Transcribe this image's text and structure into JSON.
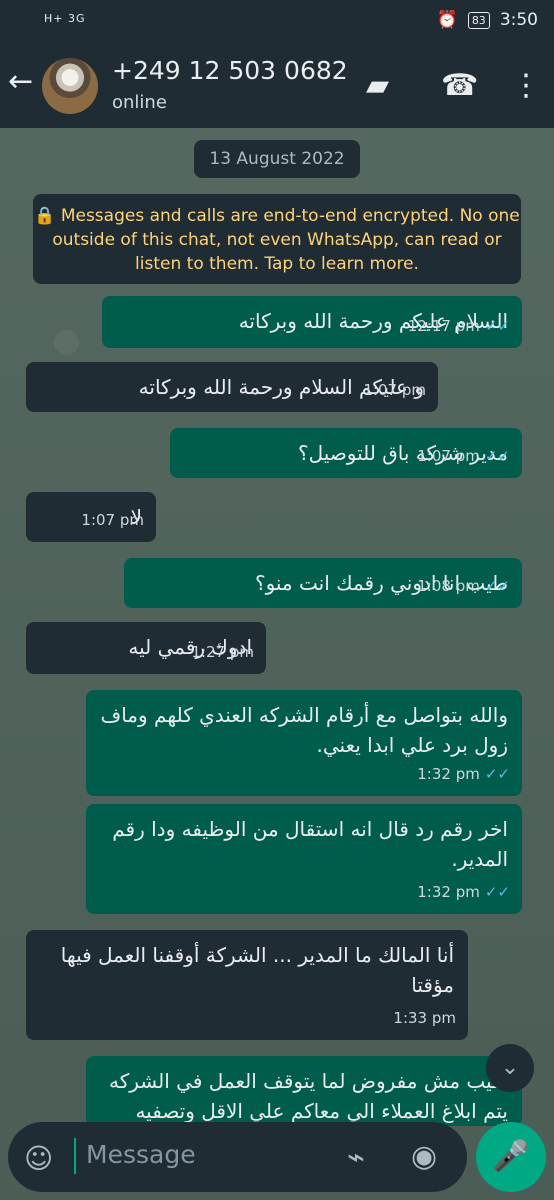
{
  "status": {
    "network": "H+ 3G",
    "battery": "83",
    "time": "3:50"
  },
  "header": {
    "title": "+249 12 503 0682",
    "subtitle": "online"
  },
  "chat": {
    "date": "13 August 2022",
    "notice": "Messages and calls are end-to-end encrypted. No one outside of this chat, not even WhatsApp, can read or listen to them. Tap to learn more.",
    "messages": [
      {
        "text": "السلام عليكم ورحمة الله وبركاته",
        "time": "12:17 pm",
        "tick": "✓✓"
      },
      {
        "text": "و عليكم السلام ورحمة الله وبركاته",
        "time": "1:07 pm"
      },
      {
        "text": "مدير شركه باق للتوصيل؟",
        "time": "1:07 pm",
        "tick": "✓✓"
      },
      {
        "text": "لا",
        "time": "1:07 pm"
      },
      {
        "text": "طيب انا ادوني رقمك انت منو؟",
        "time": "1:08 pm",
        "tick": "✓✓"
      },
      {
        "text": "ادوك رقمي ليه",
        "time": "1:27 pm"
      },
      {
        "text": "والله بتواصل مع أرقام الشركه العندي كلهم وماف زول برد علي ابدا يعني.",
        "time": "1:32 pm",
        "tick": "✓✓"
      },
      {
        "text": "اخر رقم رد قال انه استقال من الوظيفه ودا رقم المدير.",
        "time": "1:32 pm",
        "tick": "✓✓"
      },
      {
        "text": "أنا المالك ما المدير ... الشركة أوقفنا العمل فيها مؤقتا",
        "time": "1:33 pm"
      },
      {
        "text": "طيب مش مفروض لما يتوقف العمل في الشركه يتم ابلاغ العملاء الي معاكم علي الاقل وتصفيه",
        "time": ""
      }
    ]
  },
  "composer": {
    "placeholder": "Message"
  }
}
